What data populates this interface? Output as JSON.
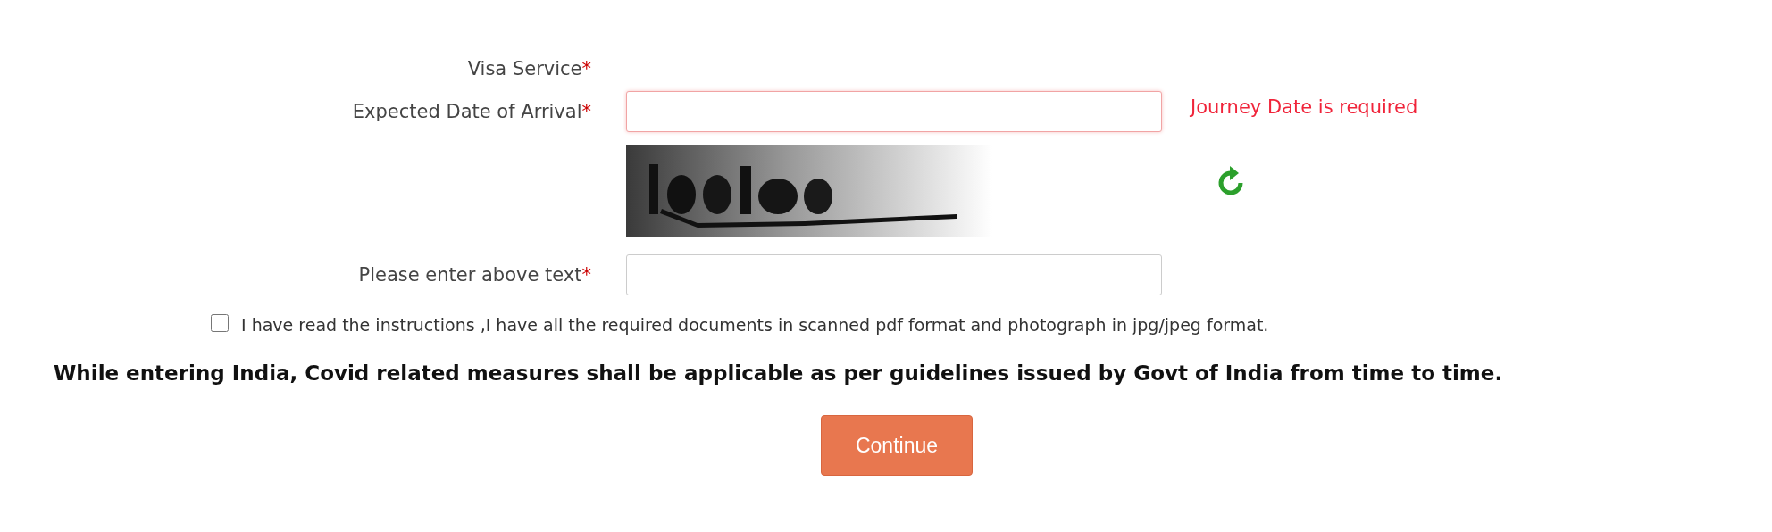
{
  "form": {
    "fields": [
      {
        "kind": "label-only",
        "label": "Visa Service",
        "mark": "*"
      },
      {
        "kind": "input",
        "label": "Expected Date of Arrival",
        "mark": "*",
        "invalid": true,
        "error": "Journey Date is required"
      },
      {
        "kind": "captcha"
      },
      {
        "kind": "input",
        "label": "Please enter above text",
        "mark": "*",
        "invalid": false
      }
    ],
    "agreement": {
      "checked": false,
      "text": "I have read the instructions ,I have all the required documents in scanned pdf format and photograph in jpg/jpeg format."
    },
    "notice": "While entering India, Covid related measures shall be applicable as per guidelines issued by Govt of India from time to time.",
    "submit": "Continue"
  }
}
